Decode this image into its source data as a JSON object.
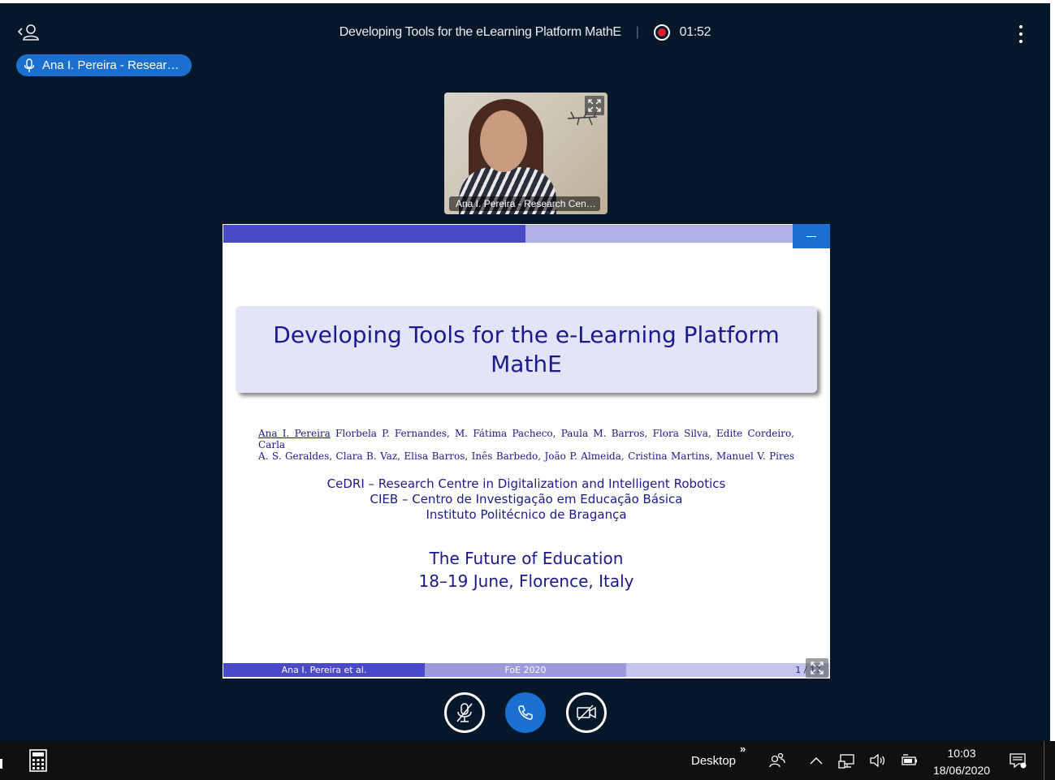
{
  "meeting": {
    "title": "Developing Tools for the eLearning Platform MathE",
    "separator": "|",
    "recording_time": "01:52"
  },
  "talker": {
    "label": "Ana I. Pereira - Resear…"
  },
  "webcam": {
    "name": "Ana I. Pereira - Research Cen…"
  },
  "slide": {
    "title": "Developing Tools for the e-Learning Platform MathE",
    "authors_first": "Ana I. Pereira",
    "authors_line1_rest": " Florbela P. Fernandes, M. Fátima Pacheco, Paula M. Barros, Flora Silva, Edite Cordeiro, Carla",
    "authors_line2": "A. S. Geraldes, Clara B. Vaz, Elisa Barros, Inês Barbedo, João P. Almeida, Cristina Martins, Manuel V. Pires",
    "affiliations": [
      "CeDRI – Research Centre in Digitalization and Intelligent Robotics",
      "CIEB – Centro de Investigação em Educação Básica",
      "Instituto Politécnico de Bragança"
    ],
    "conference": "The Future of Education",
    "conference_details": "18–19 June, Florence, Italy",
    "footer_author": "Ana I. Pereira et al.",
    "footer_event": "FoE 2020",
    "page": "1 / 17"
  },
  "taskbar": {
    "desktop_label": "Desktop",
    "overflow_chevron": "»",
    "time": "10:03",
    "date": "18/06/2020"
  },
  "colors": {
    "app_background": "#06172a",
    "accent_blue": "#1a70d1",
    "slide_navy": "#1a1a8c",
    "record_red": "#e0202a"
  },
  "icons": [
    "user-list-icon",
    "more-vertical-icon",
    "microphone-icon",
    "expand-icon",
    "minimize-icon",
    "fullscreen-icon",
    "mute-mic-icon",
    "phone-icon",
    "camera-off-icon",
    "calculator-icon",
    "people-icon",
    "chevron-up-icon",
    "network-icon",
    "volume-icon",
    "battery-icon",
    "notifications-icon"
  ]
}
